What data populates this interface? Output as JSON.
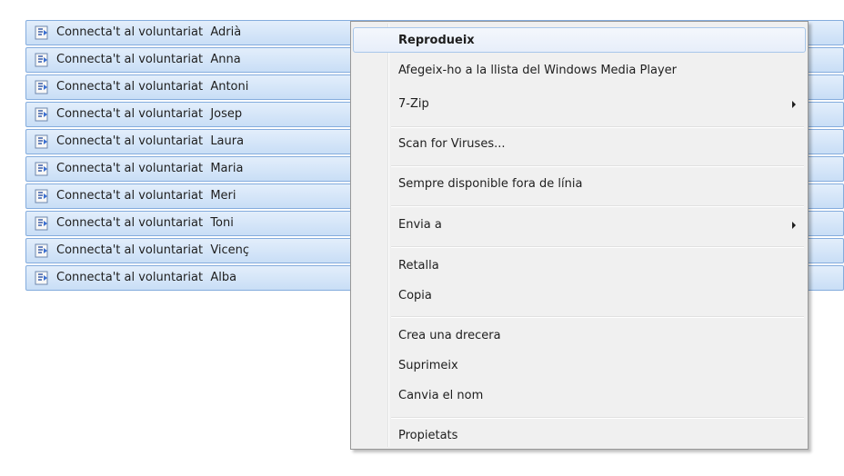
{
  "files": [
    {
      "label": "Connecta't al voluntariat  Adrià",
      "icon": "audio-file-icon"
    },
    {
      "label": "Connecta't al voluntariat  Anna",
      "icon": "audio-file-icon"
    },
    {
      "label": "Connecta't al voluntariat  Antoni",
      "icon": "audio-file-icon"
    },
    {
      "label": "Connecta't al voluntariat  Josep",
      "icon": "audio-file-icon"
    },
    {
      "label": "Connecta't al voluntariat  Laura",
      "icon": "audio-file-icon"
    },
    {
      "label": "Connecta't al voluntariat  Maria",
      "icon": "audio-file-icon"
    },
    {
      "label": "Connecta't al voluntariat  Meri",
      "icon": "audio-file-icon"
    },
    {
      "label": "Connecta't al voluntariat  Toni",
      "icon": "audio-file-icon"
    },
    {
      "label": "Connecta't al voluntariat  Vicenç",
      "icon": "audio-file-icon"
    },
    {
      "label": "Connecta't al voluntariat  Alba",
      "icon": "audio-file-icon"
    }
  ],
  "context_menu": {
    "play": "Reprodueix",
    "add_to_wmp": "Afegeix-ho a la llista del Windows Media Player",
    "seven_zip": "7-Zip",
    "scan_viruses": "Scan for Viruses...",
    "always_offline": "Sempre disponible fora de línia",
    "send_to": "Envia a",
    "cut": "Retalla",
    "copy": "Copia",
    "create_shortcut": "Crea una drecera",
    "delete": "Suprimeix",
    "rename": "Canvia el nom",
    "properties": "Propietats"
  },
  "colors": {
    "selection_border": "#84acdd",
    "selection_fill": "#c9def6",
    "menu_background": "#f0f0f0",
    "menu_hover_border": "#a8c7ea"
  }
}
